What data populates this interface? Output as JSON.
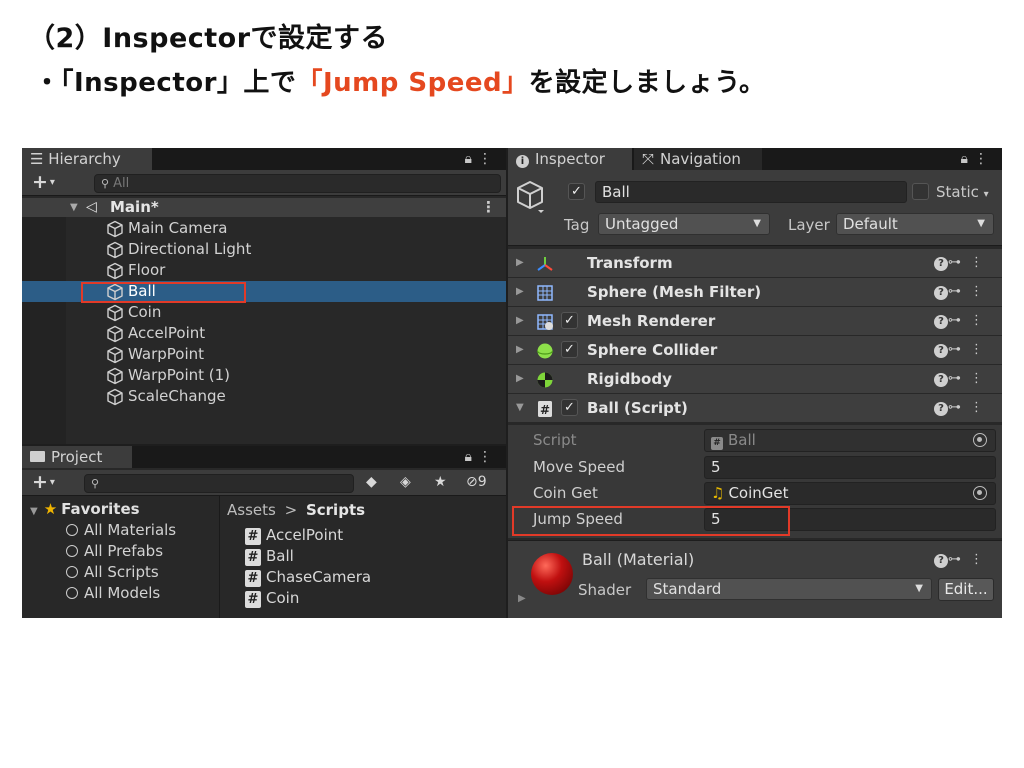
{
  "slide": {
    "title": "（2）Inspectorで設定する",
    "bullet_prefix": "・「Inspector」上で",
    "bullet_highlight": "「Jump Speed」",
    "bullet_suffix": "を設定しましょう。",
    "highlight_color": "#e5481f"
  },
  "hierarchy": {
    "tab_label": "☰ Hierarchy",
    "search_placeholder": "All",
    "scene_name": "Main*",
    "items": [
      "Main Camera",
      "Directional Light",
      "Floor",
      "Ball",
      "Coin",
      "AccelPoint",
      "WarpPoint",
      "WarpPoint (1)",
      "ScaleChange"
    ],
    "selected_item": "Ball"
  },
  "project": {
    "tab_label": "Project",
    "hidden_count": "9",
    "favorites_label": "Favorites",
    "favorites": [
      "All Materials",
      "All Prefabs",
      "All Scripts",
      "All Models"
    ],
    "breadcrumb_root": "Assets",
    "breadcrumb_sep": ">",
    "breadcrumb_current": "Scripts",
    "scripts": [
      "AccelPoint",
      "Ball",
      "ChaseCamera",
      "Coin"
    ]
  },
  "inspector": {
    "tab_label": "Inspector",
    "nav_tab_label": "Navigation",
    "object_name": "Ball",
    "static_label": "Static",
    "tag_label": "Tag",
    "tag_value": "Untagged",
    "layer_label": "Layer",
    "layer_value": "Default",
    "components": [
      {
        "name": "Transform",
        "icon": "transform-icon",
        "checkbox": false
      },
      {
        "name": "Sphere (Mesh Filter)",
        "icon": "mesh-filter-icon",
        "checkbox": false
      },
      {
        "name": "Mesh Renderer",
        "icon": "mesh-renderer-icon",
        "checkbox": true
      },
      {
        "name": "Sphere Collider",
        "icon": "sphere-collider-icon",
        "checkbox": true
      },
      {
        "name": "Rigidbody",
        "icon": "rigidbody-icon",
        "checkbox": false
      },
      {
        "name": "Ball (Script)",
        "icon": "script-icon",
        "checkbox": true
      }
    ],
    "script_props": {
      "script_label": "Script",
      "script_value": "Ball",
      "move_speed_label": "Move Speed",
      "move_speed_value": "5",
      "coin_get_label": "Coin Get",
      "coin_get_value": "CoinGet",
      "jump_speed_label": "Jump Speed",
      "jump_speed_value": "5"
    },
    "material": {
      "name": "Ball (Material)",
      "shader_label": "Shader",
      "shader_value": "Standard",
      "edit_label": "Edit..."
    }
  }
}
